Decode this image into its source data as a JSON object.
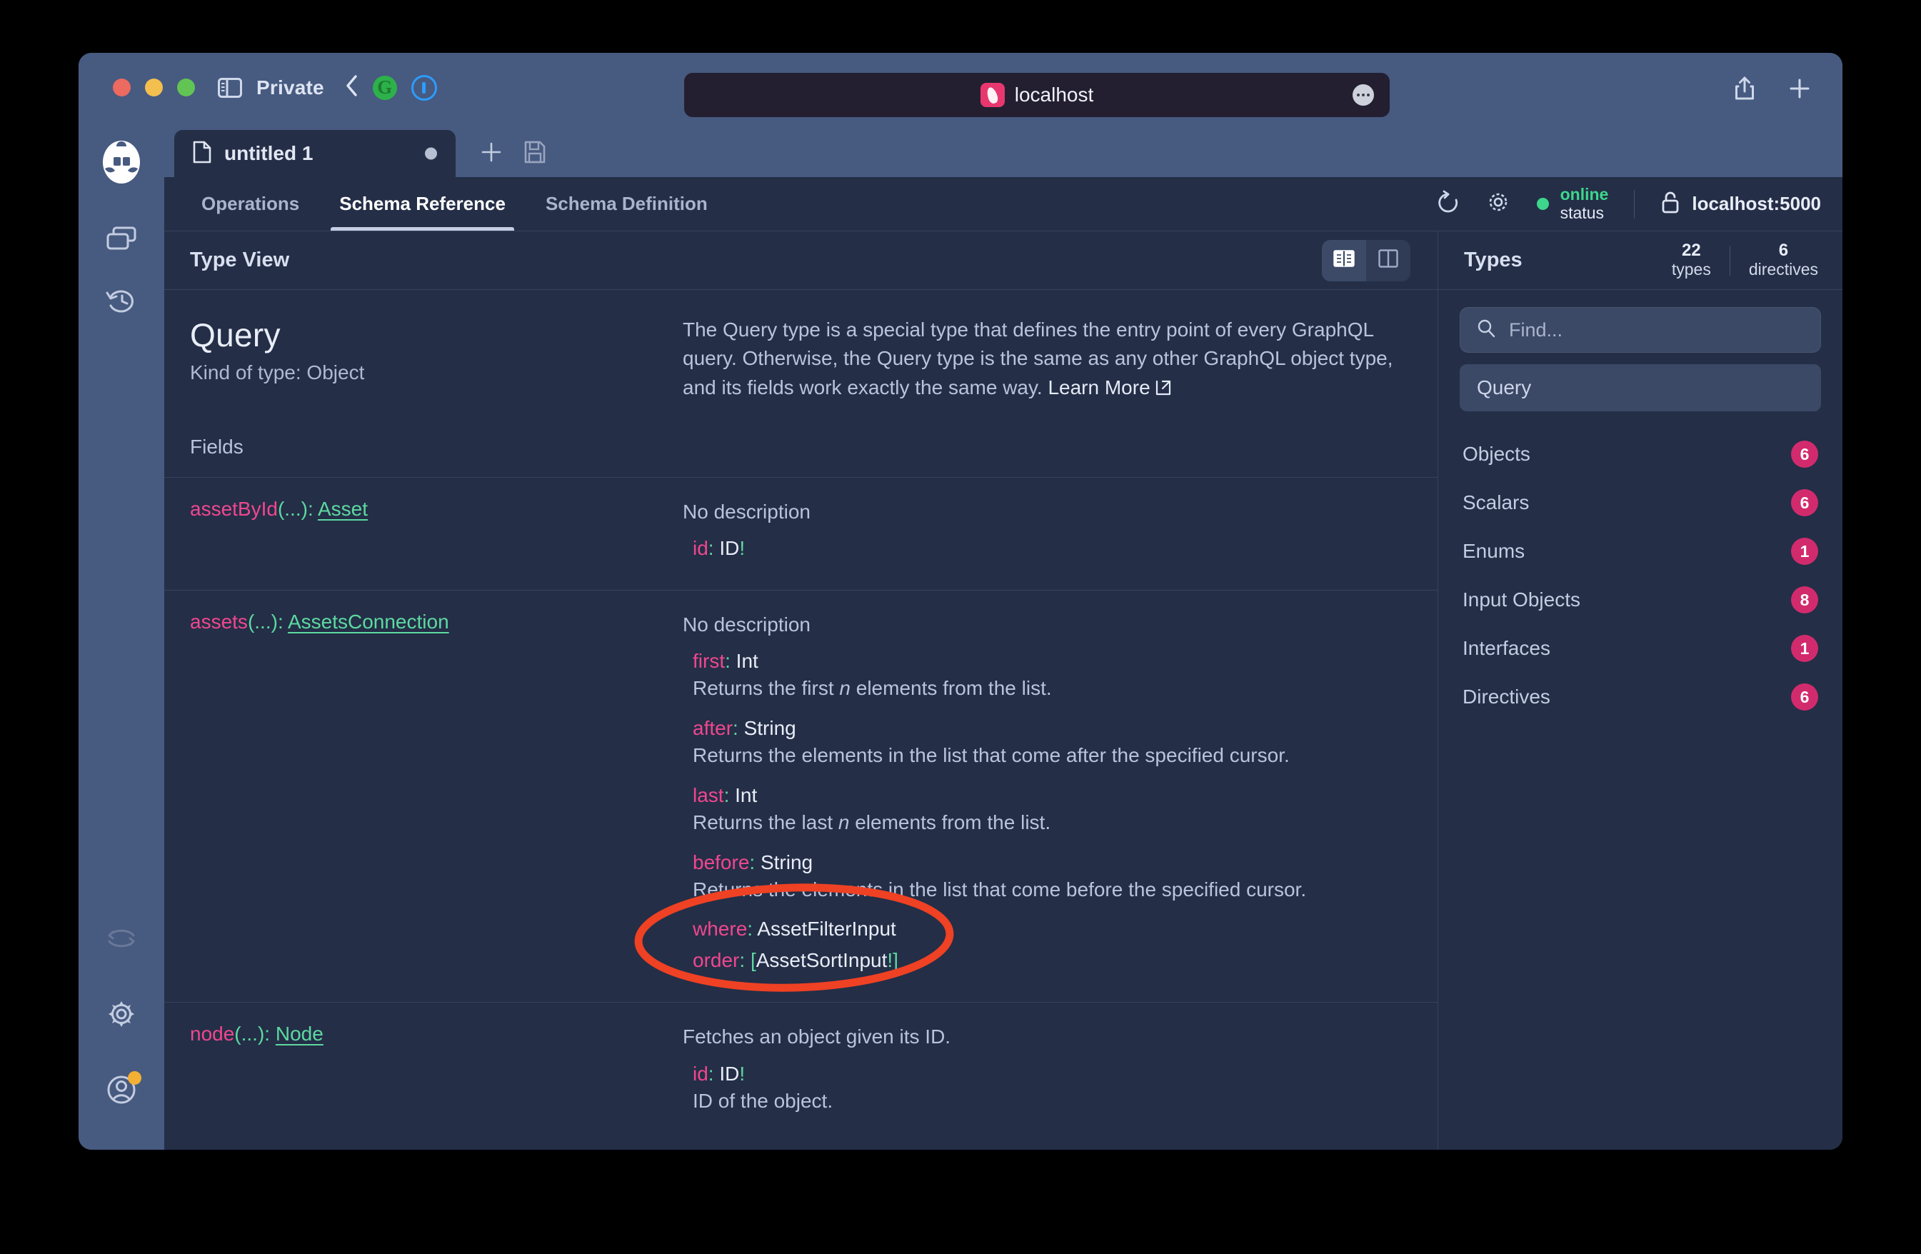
{
  "browser": {
    "private_label": "Private",
    "url_text": "localhost",
    "icons": {
      "sidebar_toggle": "sidebar-toggle-icon",
      "back": "back-chevron-icon",
      "grammarly": "grammarly-icon",
      "grammarly_letter": "G",
      "onepassword": "onepassword-icon",
      "favicon": "banana-cake-pop-favicon",
      "more": "more-options-icon",
      "share": "share-icon",
      "new_tab": "plus-icon"
    }
  },
  "rail": {
    "logo": "banana-cake-pop-logo",
    "items": [
      {
        "name": "documents-icon"
      },
      {
        "name": "history-icon"
      }
    ],
    "bottom": [
      {
        "name": "sync-icon"
      },
      {
        "name": "settings-gear-icon"
      },
      {
        "name": "user-avatar-icon"
      }
    ]
  },
  "tabs": {
    "document": {
      "label": "untitled 1",
      "unsaved": true
    },
    "add_label": "+",
    "save_label": "save"
  },
  "nav": {
    "tabs": [
      {
        "label": "Operations",
        "active": false
      },
      {
        "label": "Schema Reference",
        "active": true
      },
      {
        "label": "Schema Definition",
        "active": false
      }
    ],
    "refresh": "refresh-icon",
    "settings": "settings-gear-icon",
    "status_online": "online",
    "status_label": "status",
    "status_color": "#3dd68c",
    "lock": "unlock-icon",
    "endpoint": "localhost:5000"
  },
  "doc_pane": {
    "title": "Type View",
    "view_buttons": [
      {
        "name": "reference-view-button",
        "active": true
      },
      {
        "name": "split-view-button",
        "active": false
      }
    ],
    "type_name": "Query",
    "type_kind": "Kind of type: Object",
    "type_description": "The Query type is a special type that defines the entry point of every GraphQL query. Otherwise, the Query type is the same as any other GraphQL object type, and its fields work exactly the same way.",
    "learn_more": "Learn More",
    "fields_label": "Fields",
    "fields": [
      {
        "name": "assetById",
        "paren": "(...)",
        "colon": ":",
        "return_type": "Asset",
        "description": "No description",
        "args": [
          {
            "name": "id",
            "type": "ID",
            "bang": "!",
            "desc": ""
          }
        ]
      },
      {
        "name": "assets",
        "paren": "(...)",
        "colon": ":",
        "return_type": "AssetsConnection",
        "description": "No description",
        "args": [
          {
            "name": "first",
            "type": "Int",
            "bang": "",
            "desc": "Returns the first n elements from the list."
          },
          {
            "name": "after",
            "type": "String",
            "bang": "",
            "desc": "Returns the elements in the list that come after the specified cursor."
          },
          {
            "name": "last",
            "type": "Int",
            "bang": "",
            "desc": "Returns the last n elements from the list."
          },
          {
            "name": "before",
            "type": "String",
            "bang": "",
            "desc": "Returns the elements in the list that come before the specified cursor."
          },
          {
            "name": "where",
            "type": "AssetFilterInput",
            "bang": "",
            "desc": ""
          },
          {
            "name": "order",
            "type": "AssetSortInput",
            "bang": "!",
            "list": true,
            "desc": ""
          }
        ]
      },
      {
        "name": "node",
        "paren": "(...)",
        "colon": ":",
        "return_type": "Node",
        "description": "Fetches an object given its ID.",
        "args": [
          {
            "name": "id",
            "type": "ID",
            "bang": "!",
            "desc": "ID of the object."
          }
        ]
      }
    ]
  },
  "types_pane": {
    "title": "Types",
    "types_count": "22",
    "types_label": "types",
    "directives_count": "6",
    "directives_label": "directives",
    "find_placeholder": "Find...",
    "find_value": "",
    "selected_type": "Query",
    "categories": [
      {
        "label": "Objects",
        "count": "6"
      },
      {
        "label": "Scalars",
        "count": "6"
      },
      {
        "label": "Enums",
        "count": "1"
      },
      {
        "label": "Input Objects",
        "count": "8"
      },
      {
        "label": "Interfaces",
        "count": "1"
      },
      {
        "label": "Directives",
        "count": "6"
      }
    ]
  },
  "annotation": {
    "shape": "ellipse-highlight",
    "color": "#ef4123",
    "targets": "where: AssetFilterInput, order: [AssetSortInput!]"
  },
  "colors": {
    "window_chrome": "#475a80",
    "app_bg": "#242e47",
    "field_name": "#f0478f",
    "type_link": "#5dd9a0",
    "badge": "#d22b6d",
    "online": "#3dd68c",
    "annotation": "#ef4123"
  }
}
